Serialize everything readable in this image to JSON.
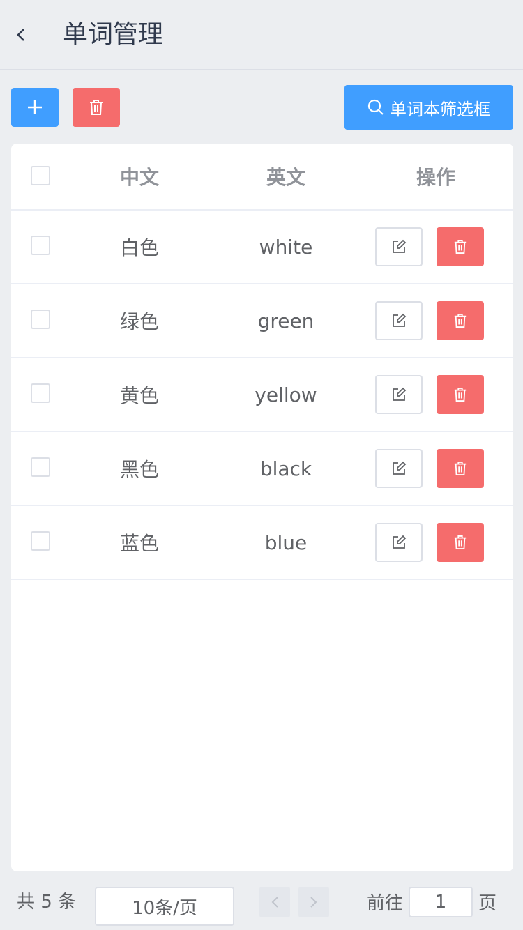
{
  "header": {
    "title": "单词管理",
    "back_icon": "chevron-left-icon"
  },
  "toolbar": {
    "add_icon": "plus-icon",
    "delete_icon": "trash-icon",
    "filter_label": "单词本筛选框",
    "filter_icon": "search-icon"
  },
  "table": {
    "columns": [
      "中文",
      "英文",
      "操作"
    ],
    "rows": [
      {
        "cn": "白色",
        "en": "white"
      },
      {
        "cn": "绿色",
        "en": "green"
      },
      {
        "cn": "黄色",
        "en": "yellow"
      },
      {
        "cn": "黑色",
        "en": "black"
      },
      {
        "cn": "蓝色",
        "en": "blue"
      }
    ]
  },
  "pagination": {
    "total": "共 5 条",
    "page_size": "10条/页",
    "goto_label": "前往",
    "current_page": "1",
    "goto_suffix": "页"
  },
  "colors": {
    "primary": "#409eff",
    "danger": "#f56c6c",
    "background": "#eceef1"
  }
}
